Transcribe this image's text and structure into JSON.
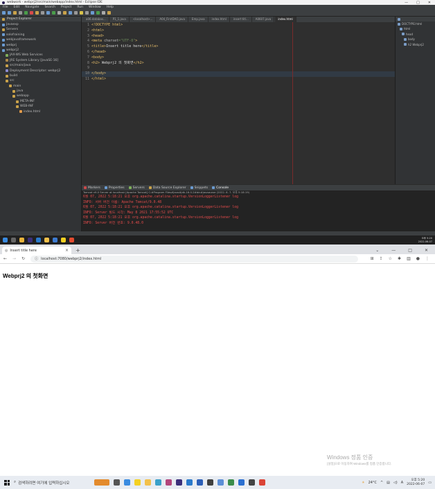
{
  "eclipse": {
    "title": "webwork - webprj2/src/main/webapp/index.html - Eclipse IDE",
    "window_controls": [
      "—",
      "□",
      "✕"
    ],
    "menu": [
      "File",
      "Edit",
      "Navigate",
      "Search",
      "Project",
      "Run",
      "Window",
      "Help"
    ],
    "project_explorer": {
      "title": "Project Explorer",
      "tree": [
        {
          "label": "Javaexp",
          "indent": 0,
          "icon": "project-icon"
        },
        {
          "label": "Servers",
          "indent": 0,
          "icon": "folder-icon"
        },
        {
          "label": "solofraining",
          "indent": 0,
          "icon": "project-icon"
        },
        {
          "label": "webjavaframework",
          "indent": 0,
          "icon": "project-icon"
        },
        {
          "label": "webprj",
          "indent": 0,
          "icon": "project-icon"
        },
        {
          "label": "webprj2",
          "indent": 0,
          "icon": "project-icon"
        },
        {
          "label": "JAX-WS Web Services",
          "indent": 1,
          "icon": "service-icon"
        },
        {
          "label": "JRE System Library [JavaSE-16]",
          "indent": 1,
          "icon": "library-icon"
        },
        {
          "label": "src/main/java",
          "indent": 1,
          "icon": "package-folder-icon"
        },
        {
          "label": "Deployment Descriptor: webprj2",
          "indent": 1,
          "icon": "descriptor-icon"
        },
        {
          "label": "build",
          "indent": 1,
          "icon": "folder-icon"
        },
        {
          "label": "src",
          "indent": 1,
          "icon": "folder-icon"
        },
        {
          "label": "main",
          "indent": 2,
          "icon": "folder-icon"
        },
        {
          "label": "java",
          "indent": 3,
          "icon": "folder-icon"
        },
        {
          "label": "webapp",
          "indent": 3,
          "icon": "folder-icon"
        },
        {
          "label": "META-INF",
          "indent": 4,
          "icon": "folder-icon"
        },
        {
          "label": "WEB-INF",
          "indent": 4,
          "icon": "folder-icon"
        },
        {
          "label": "index.html",
          "indent": 5,
          "icon": "html-file-icon"
        }
      ]
    },
    "editor_tabs": [
      "a06.databas...",
      "P1_1.java",
      "<localhost>...",
      "A04_FirstDAO.java",
      "Emp.java",
      "index.html",
      "insert titl...",
      "A0607.java",
      "index.html"
    ],
    "active_tab": "index.html",
    "code_lines": [
      {
        "n": "1",
        "segments": [
          {
            "t": "<!DOCTYPE html>",
            "c": "#e8bf6a"
          }
        ]
      },
      {
        "n": "2",
        "segments": [
          {
            "t": "<html>",
            "c": "#e8bf6a"
          }
        ]
      },
      {
        "n": "3",
        "segments": [
          {
            "t": "<head>",
            "c": "#e8bf6a"
          }
        ]
      },
      {
        "n": "4",
        "segments": [
          {
            "t": "<meta ",
            "c": "#e8bf6a"
          },
          {
            "t": "charset",
            "c": "#bababa"
          },
          {
            "t": "=\"UTF-8\"",
            "c": "#6a8759"
          },
          {
            "t": ">",
            "c": "#e8bf6a"
          }
        ]
      },
      {
        "n": "5",
        "segments": [
          {
            "t": "<title>",
            "c": "#e8bf6a"
          },
          {
            "t": "Insert title here",
            "c": "#dddddd"
          },
          {
            "t": "</title>",
            "c": "#e8bf6a"
          }
        ]
      },
      {
        "n": "6",
        "segments": [
          {
            "t": "</head>",
            "c": "#e8bf6a"
          }
        ]
      },
      {
        "n": "7",
        "segments": [
          {
            "t": "<body>",
            "c": "#e8bf6a"
          }
        ]
      },
      {
        "n": "8",
        "segments": [
          {
            "t": "<h2>",
            "c": "#e8bf6a"
          },
          {
            "t": " Webprj2 의 첫화면",
            "c": "#dddddd"
          },
          {
            "t": "</h2>",
            "c": "#e8bf6a"
          }
        ]
      },
      {
        "n": "9",
        "segments": []
      },
      {
        "n": "10",
        "segments": [
          {
            "t": "</body>",
            "c": "#e8bf6a"
          }
        ],
        "highlight": true
      },
      {
        "n": "11",
        "segments": [
          {
            "t": "</html>",
            "c": "#e8bf6a"
          }
        ]
      }
    ],
    "outline": [
      "DOCTYPE:html",
      "html",
      "head",
      "body",
      "h2 Webprj2"
    ],
    "console": {
      "tabs": [
        "Markers",
        "Properties",
        "Servers",
        "Data Source Explorer",
        "Snippets",
        "Console"
      ],
      "active_tab": "Console",
      "header": "Tomcat v9.0 Server at localhost [Apache Tomcat] C:#Program Files#Java#jdk-16.0.2#bin#javaw.exe  (2022. 6. 7. 오후 5:18:19)",
      "lines": [
        "6월 07, 2022 5:18:21 오후 org.apache.catalina.startup.VersionLoggerListener log",
        "INFO: 서버 버전 이름:    Apache Tomcat/9.0.48",
        "6월 07, 2022 5:18:21 오후 org.apache.catalina.startup.VersionLoggerListener log",
        "INFO: Server 빌드 시각:  May 8 2021 17:55:52 UTC",
        "6월 07, 2022 5:18:21 오후 org.apache.catalina.startup.VersionLoggerListener log",
        "INFO: Server 버전 번호:  9.0.48.0"
      ]
    }
  },
  "mini_taskbar": {
    "time": "오후 5:20",
    "date": "2022-06-07"
  },
  "browser": {
    "tab_title": "Insert title here",
    "url": "localhost:7080/webprj2/index.html",
    "page_heading": "Webprj2 의 첫화면",
    "window_controls": [
      "⌄",
      "—",
      "□",
      "✕"
    ]
  },
  "watermark": {
    "line1": "Windows 정품 인증",
    "line2": "[설정]으로 이동하여 Windows를 정품 인증합니다."
  },
  "taskbar": {
    "search_placeholder": "검색하려면 여기에 입력하십시오",
    "weather": "24°C",
    "ime": "A",
    "time": "오후 5:20",
    "date": "2022-06-07"
  }
}
